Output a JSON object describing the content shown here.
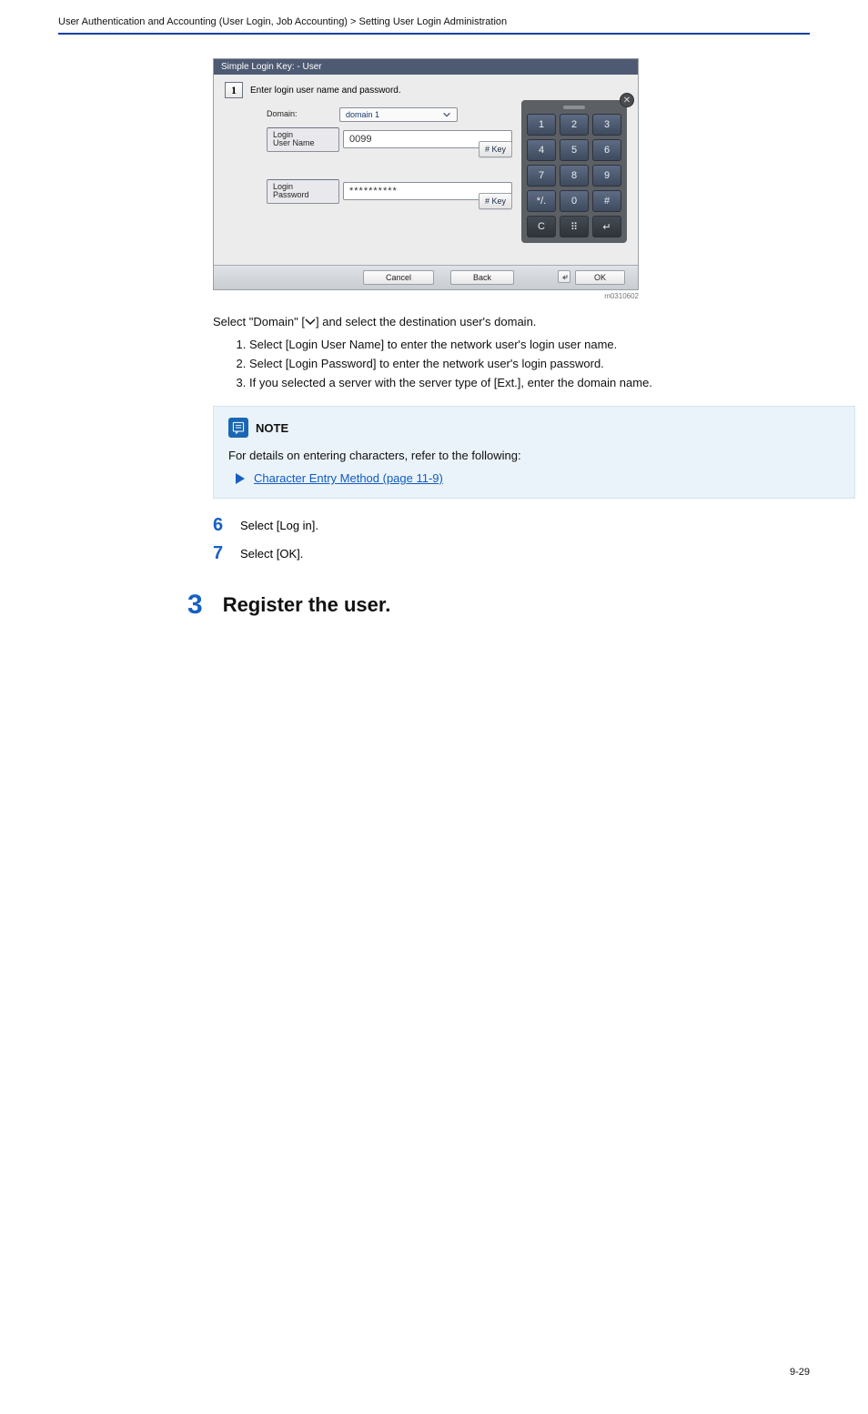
{
  "header": {
    "left": "User Authentication and Accounting (User Login, Job Accounting) > Setting User Login Administration",
    "right": ""
  },
  "screenshot": {
    "titlebar": "Simple Login Key:    - User",
    "step_num": "1",
    "instruction": "Enter login user name and password.",
    "domain_label": "Domain:",
    "domain_value": "domain 1",
    "login_name_label": "Login\nUser Name",
    "login_name_value": "0099",
    "login_pw_label": "Login\nPassword",
    "login_pw_value": "**********",
    "key_btn": "# Key",
    "keypad_keys": [
      "1",
      "2",
      "3",
      "4",
      "5",
      "6",
      "7",
      "8",
      "9",
      "*/.",
      "0",
      "#",
      "C",
      "⠿",
      "↵"
    ],
    "cancel": "Cancel",
    "back": "Back",
    "ok": "OK",
    "code": "m0310602"
  },
  "before_list_lead": "Select \"Domain\" [",
  "before_list_trail": "] and select the destination user's domain.",
  "list_items": [
    "Select [Login User Name] to enter the network user's login user name.",
    "Select [Login Password] to enter the network user's login password.",
    "If you selected a server with the server type of [Ext.], enter the domain name."
  ],
  "note": {
    "title": "NOTE",
    "body": "For details on entering characters, refer to the following:",
    "link": "Character Entry Method (page 11-9)"
  },
  "steps_after": [
    {
      "num": "6",
      "text": "Select [Log in]."
    },
    {
      "num": "7",
      "text": "Select [OK]."
    }
  ],
  "bigstep": {
    "num": "3",
    "text": "Register the user."
  },
  "footer": {
    "left": "",
    "right": "9-29"
  }
}
